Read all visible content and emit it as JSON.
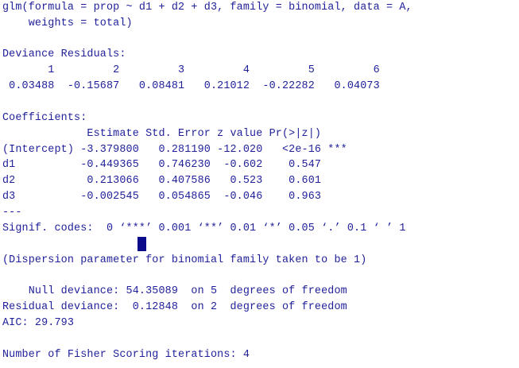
{
  "console": {
    "lines": [
      "glm(formula = prop ~ d1 + d2 + d3, family = binomial, data = A,",
      "    weights = total)",
      "",
      "Deviance Residuals:",
      "       1         2         3         4         5         6",
      " 0.03488  -0.15687   0.08481   0.21012  -0.22282   0.04073",
      "",
      "Coefficients:",
      "             Estimate Std. Error z value Pr(>|z|)",
      "(Intercept) -3.379800   0.281190 -12.020   <2e-16 ***",
      "d1          -0.449365   0.746230  -0.602    0.547",
      "d2           0.213066   0.407586   0.523    0.601",
      "d3          -0.002545   0.054865  -0.046    0.963",
      "---",
      "Signif. codes:  0 ‘***’ 0.001 ‘**’ 0.01 ‘*’ 0.05 ‘.’ 0.1 ‘ ’ 1",
      "",
      "(Dispersion parameter for binomial family taken to be 1)",
      "",
      "    Null deviance: 54.35089  on 5  degrees of freedom",
      "Residual deviance:  0.12848  on 2  degrees of freedom",
      "AIC: 29.793",
      "",
      "Number of Fisher Scoring iterations: 4"
    ]
  }
}
